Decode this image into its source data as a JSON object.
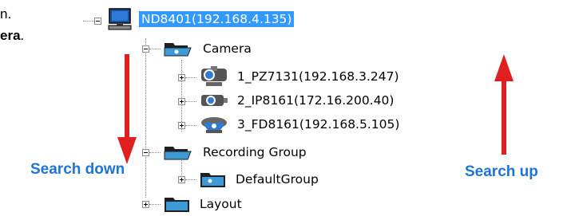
{
  "document": {
    "line1_suffix": "n.",
    "line2_prefix": "era",
    "line2_suffix": "."
  },
  "tree": {
    "root": {
      "label": "ND8401(192.168.4.135)",
      "icon": "computer-icon",
      "selected": true
    },
    "camera_group": {
      "label": "Camera",
      "icon": "folder-open-icon"
    },
    "cameras": [
      {
        "label": "1_PZ7131(192.168.3.247)",
        "icon": "ptz-camera-icon"
      },
      {
        "label": "2_IP8161(172.16.200.40)",
        "icon": "bullet-camera-icon"
      },
      {
        "label": "3_FD8161(192.168.5.105)",
        "icon": "dome-camera-icon"
      }
    ],
    "recording_group": {
      "label": "Recording Group",
      "icon": "folder-open-icon"
    },
    "default_group": {
      "label": "DefaultGroup",
      "icon": "folder-icon"
    },
    "layout": {
      "label": "Layout",
      "icon": "folder-icon"
    }
  },
  "annotations": {
    "search_down": "Search down",
    "search_up": "Search up",
    "arrow_color": "#e02020",
    "text_color": "#1e73d6"
  },
  "colors": {
    "selection": "#3399ff",
    "folder": "#3c9bd6"
  }
}
